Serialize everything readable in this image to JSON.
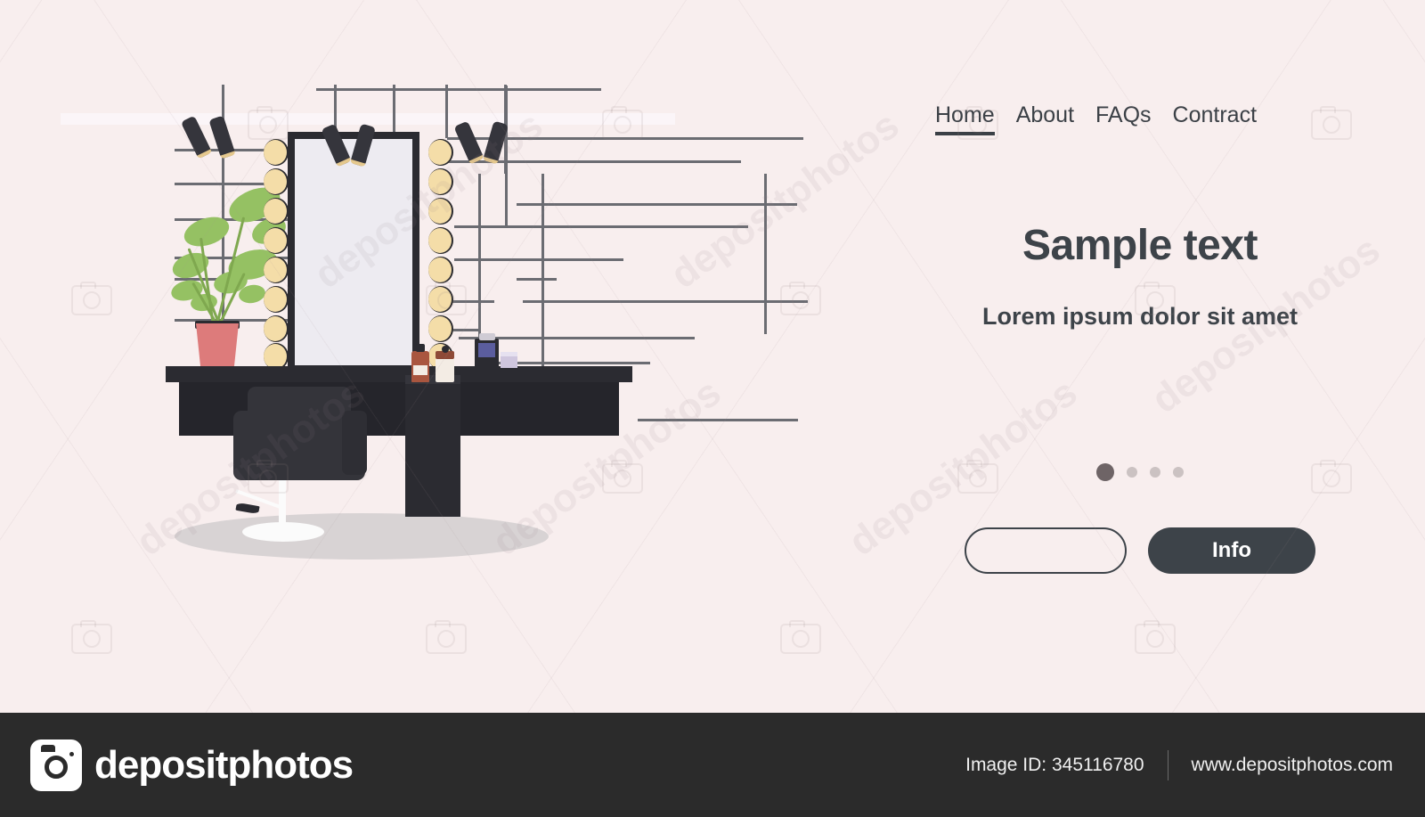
{
  "page": {
    "background_color": "#f8eeee",
    "accent_dark": "#3d4349",
    "watermark_text": "depositphotos"
  },
  "nav": {
    "items": [
      {
        "label": "Home",
        "active": true
      },
      {
        "label": "About",
        "active": false
      },
      {
        "label": "FAQs",
        "active": false
      },
      {
        "label": "Contract",
        "active": false
      }
    ]
  },
  "hero": {
    "headline": "Sample text",
    "subhead": "Lorem ipsum dolor sit amet"
  },
  "carousel": {
    "dots": [
      {
        "active": true
      },
      {
        "active": false
      },
      {
        "active": false
      },
      {
        "active": false
      }
    ],
    "active_index": 0,
    "count": 4
  },
  "buttons": {
    "secondary_label": "",
    "primary_label": "Info"
  },
  "illustration": {
    "scene_name": "beauty-salon-makeup-mirror-vanity",
    "mirror": {
      "bulbs_per_side": 8,
      "bulb_color": "#f4dda8",
      "frame_color": "#2b2b31",
      "glass_color": "#edebf1"
    },
    "spotlights": {
      "count": 6,
      "color": "#35353c"
    },
    "plant": {
      "pot_color": "#dd7b7b",
      "leaf_color": "#95c163",
      "leaf_count": 9
    },
    "chair": {
      "body_color": "#34343a",
      "base_color": "#fbfbfb"
    },
    "counter": {
      "color": "#2b2b31"
    },
    "floor_shadow_color": "#d8d3d4",
    "products": [
      {
        "name": "tall-brown-bottle",
        "color": "#a9563f"
      },
      {
        "name": "short-white-bottle",
        "color": "#f3ece4"
      },
      {
        "name": "styling-device",
        "color": "#2b2b31"
      },
      {
        "name": "small-lavender-box",
        "color": "#cfc6de"
      }
    ]
  },
  "footer": {
    "brand": "depositphotos",
    "image_id_label": "Image ID: 345116780",
    "website": "www.depositphotos.com",
    "background_color": "#2b2b2b"
  }
}
